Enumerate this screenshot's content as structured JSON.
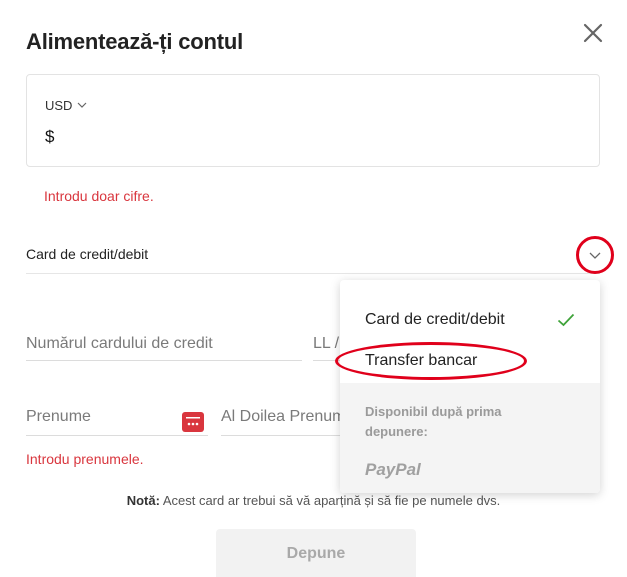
{
  "dialog": {
    "title": "Alimentează-ți contul",
    "close_icon": "close-icon"
  },
  "amount": {
    "currency": "USD",
    "value": "$"
  },
  "errors": {
    "digits": "Introdu doar cifre.",
    "first_name": "Introdu prenumele."
  },
  "payment_method": {
    "selected": "Card de credit/debit",
    "options": [
      {
        "label": "Card de credit/debit",
        "selected": true
      },
      {
        "label": "Transfer bancar",
        "selected": false
      }
    ],
    "unavailable_note": "Disponibil după prima depunere:",
    "unavailable_option": "PayPal"
  },
  "fields": {
    "card_number": "Numărul cardului de credit",
    "expiry": "LL / AA",
    "first_name": "Prenume",
    "middle_name": "Al Doilea Prenume"
  },
  "note": {
    "label": "Notă:",
    "text": " Acest card ar trebui să vă aparțină și să fie pe numele dvs."
  },
  "submit": {
    "label": "Depune"
  },
  "colors": {
    "error": "#d9363e",
    "annotation": "#e0001b",
    "check": "#3fa33a"
  }
}
